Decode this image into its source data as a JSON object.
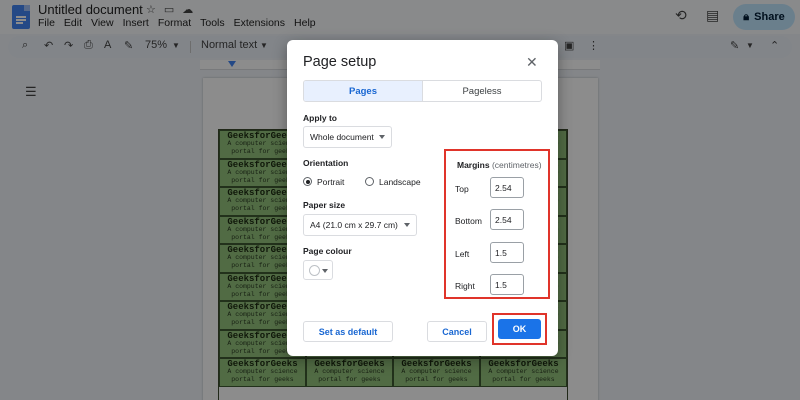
{
  "app": {
    "doc_title": "Untitled document",
    "menu": [
      "File",
      "Edit",
      "View",
      "Insert",
      "Format",
      "Tools",
      "Extensions",
      "Help"
    ],
    "share_label": "Share"
  },
  "toolbar": {
    "zoom": "75%",
    "style": "Normal text"
  },
  "document": {
    "cell_title": "GeeksforGeeks",
    "cell_subtitle_1": "A computer science",
    "cell_subtitle_2": "portal for geeks",
    "cell_color": "#94c47d"
  },
  "dialog": {
    "title": "Page setup",
    "tabs": [
      {
        "label": "Pages",
        "active": true
      },
      {
        "label": "Pageless",
        "active": false
      }
    ],
    "apply_to": {
      "label": "Apply to",
      "value": "Whole document"
    },
    "orientation": {
      "label": "Orientation",
      "options": [
        "Portrait",
        "Landscape"
      ],
      "selected": "Portrait"
    },
    "paper_size": {
      "label": "Paper size",
      "value": "A4 (21.0 cm x 29.7 cm)"
    },
    "page_colour": {
      "label": "Page colour",
      "value": "#ffffff"
    },
    "margins": {
      "title": "Margins",
      "unit": "(centimetres)",
      "top": {
        "label": "Top",
        "value": "2.54"
      },
      "bottom": {
        "label": "Bottom",
        "value": "2.54"
      },
      "left": {
        "label": "Left",
        "value": "1.5"
      },
      "right": {
        "label": "Right",
        "value": "1.5"
      }
    },
    "buttons": {
      "set_default": "Set as default",
      "cancel": "Cancel",
      "ok": "OK"
    },
    "highlight_color": "#e0342a",
    "accent_color": "#1a73e8"
  }
}
